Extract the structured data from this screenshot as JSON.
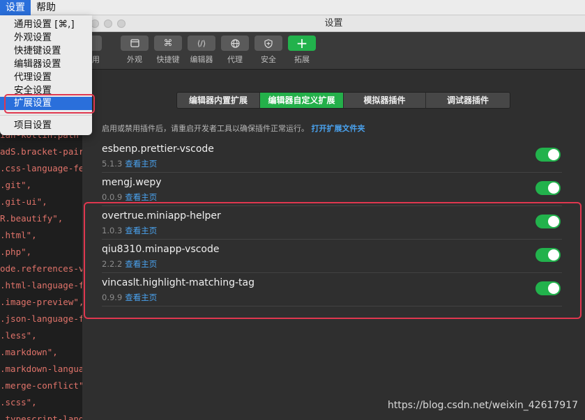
{
  "menubar": {
    "items": [
      {
        "label": "设置",
        "active": true
      },
      {
        "label": "帮助",
        "active": false
      }
    ]
  },
  "dropdown": {
    "items": [
      "通用设置 [⌘,]",
      "外观设置",
      "快捷键设置",
      "编辑器设置",
      "代理设置",
      "安全设置",
      "扩展设置",
      "项目设置"
    ],
    "selected": "扩展设置"
  },
  "editor_lines": [
    [
      "",
      "ian-kotlin.path"
    ],
    [
      "",
      "adS.bracket-pair"
    ],
    [
      "",
      ".css-language-fe"
    ],
    [
      "",
      ".git\","
    ],
    [
      "",
      ".git-ui\","
    ],
    [
      "",
      "R.beautify\","
    ],
    [
      "",
      ".html\","
    ],
    [
      "",
      ".php\","
    ],
    [
      "",
      "ode.references-v"
    ],
    [
      "",
      ".html-language-f"
    ],
    [
      "",
      ".image-preview\","
    ],
    [
      "",
      ".json-language-f"
    ],
    [
      "",
      ".less\","
    ],
    [
      "",
      ".markdown\","
    ],
    [
      "",
      ".markdown-langua"
    ],
    [
      "",
      ".merge-conflict\""
    ],
    [
      "",
      ".scss\","
    ],
    [
      "",
      ".typescript-lang"
    ]
  ],
  "window": {
    "title": "设置",
    "toolbar": [
      {
        "label": "通用",
        "icon": "sliders-icon"
      },
      {
        "label": "外观",
        "icon": "window-icon"
      },
      {
        "label": "快捷键",
        "icon": "command-icon"
      },
      {
        "label": "编辑器",
        "icon": "code-icon"
      },
      {
        "label": "代理",
        "icon": "globe-icon"
      },
      {
        "label": "安全",
        "icon": "shield-icon"
      },
      {
        "label": "拓展",
        "icon": "plus-icon"
      }
    ],
    "tabs": [
      {
        "label": "编辑器内置扩展",
        "active": false
      },
      {
        "label": "编辑器自定义扩展",
        "active": true
      },
      {
        "label": "模拟器插件",
        "active": false
      },
      {
        "label": "调试器插件",
        "active": false
      }
    ],
    "hint": {
      "text": "启用或禁用插件后，请重启开发者工具以确保插件正常运行。",
      "link": "打开扩展文件夹"
    },
    "extensions": [
      {
        "name": "esbenp.prettier-vscode",
        "version": "5.1.3",
        "link": "查看主页",
        "enabled": true
      },
      {
        "name": "mengj.wepy",
        "version": "0.0.9",
        "link": "查看主页",
        "enabled": true
      },
      {
        "name": "overtrue.miniapp-helper",
        "version": "1.0.3",
        "link": "查看主页",
        "enabled": true
      },
      {
        "name": "qiu8310.minapp-vscode",
        "version": "2.2.2",
        "link": "查看主页",
        "enabled": true
      },
      {
        "name": "vincaslt.highlight-matching-tag",
        "version": "0.9.9",
        "link": "查看主页",
        "enabled": true
      }
    ]
  },
  "watermark": "https://blog.csdn.net/weixin_42617917",
  "colors": {
    "accent_green": "#22b24c",
    "link_blue": "#4aa3f0",
    "highlight_red": "#e0374f",
    "menu_selected": "#2a6fdb"
  }
}
